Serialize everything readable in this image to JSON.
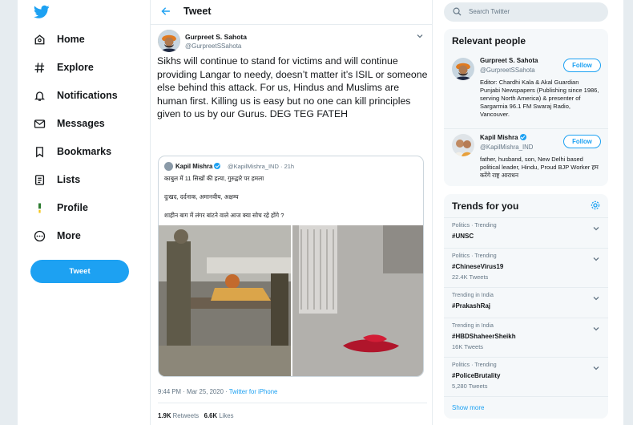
{
  "nav": {
    "items": [
      {
        "label": "Home",
        "icon": "home-icon"
      },
      {
        "label": "Explore",
        "icon": "hashtag-icon"
      },
      {
        "label": "Notifications",
        "icon": "bell-icon"
      },
      {
        "label": "Messages",
        "icon": "envelope-icon"
      },
      {
        "label": "Bookmarks",
        "icon": "bookmark-icon"
      },
      {
        "label": "Lists",
        "icon": "list-icon"
      },
      {
        "label": "Profile",
        "icon": "profile-icon"
      },
      {
        "label": "More",
        "icon": "more-icon"
      }
    ],
    "tweet_button": "Tweet"
  },
  "header": {
    "title": "Tweet"
  },
  "tweet": {
    "author_name": "Gurpreet S. Sahota",
    "author_handle": "@GurpreetSSahota",
    "text": "Sikhs will continue to stand for victims and will continue providing Langar to needy, doesn’t matter it’s ISIL or someone else behind this attack. For us, Hindus and Muslims are human first. Killing us is easy but no one can kill principles given to us by our Gurus. DEG TEG FATEH",
    "quote": {
      "author_name": "Kapil Mishra",
      "author_handle": "@KapilMishra_IND",
      "time": "21h",
      "lines": [
        "काबुल में 11 सिखों की हत्या, गुरुद्वारे पर हमला",
        "दुःखद, दर्दनाक, अमानवीय, अक्षम्य",
        "शाहीन बाग में लंगर बांटने वाले आज क्या सोच रहे होंगे ?"
      ]
    },
    "timestamp": "9:44 PM · Mar 25, 2020 · ",
    "source": "Twitter for iPhone",
    "retweets": "1.9K",
    "retweets_label": "Retweets",
    "likes": "6.6K",
    "likes_label": "Likes"
  },
  "search": {
    "placeholder": "Search Twitter"
  },
  "relevant": {
    "title": "Relevant people",
    "people": [
      {
        "name": "Gurpreet S. Sahota",
        "handle": "@GurpreetSSahota",
        "bio": "Editor: Chardhi Kala & Akal Guardian Punjabi Newspapers (Publishing since 1986, serving North America) & presenter of Sargarmia 96.1 FM Swaraj Radio, Vancouver.",
        "follow_label": "Follow"
      },
      {
        "name": "Kapil Mishra",
        "handle": "@KapilMishra_IND",
        "bio": "father, husband, son, New Delhi based political leader, Hindu, Proud BJP Worker हम करेंगे राष्ट्र आराधन",
        "follow_label": "Follow"
      }
    ]
  },
  "trends": {
    "title": "Trends for you",
    "items": [
      {
        "context": "Politics · Trending",
        "name": "#UNSC",
        "count": ""
      },
      {
        "context": "Politics · Trending",
        "name": "#ChineseVirus19",
        "count": "22.4K Tweets"
      },
      {
        "context": "Trending in India",
        "name": "#PrakashRaj",
        "count": ""
      },
      {
        "context": "Trending in India",
        "name": "#HBDShaheerSheikh",
        "count": "16K Tweets"
      },
      {
        "context": "Politics · Trending",
        "name": "#PoliceBrutality",
        "count": "5,280 Tweets"
      }
    ],
    "show_more": "Show more"
  },
  "colors": {
    "accent": "#1da1f2",
    "background": "#e6ecf0",
    "muted": "#657786",
    "panel": "#f5f8fa"
  }
}
